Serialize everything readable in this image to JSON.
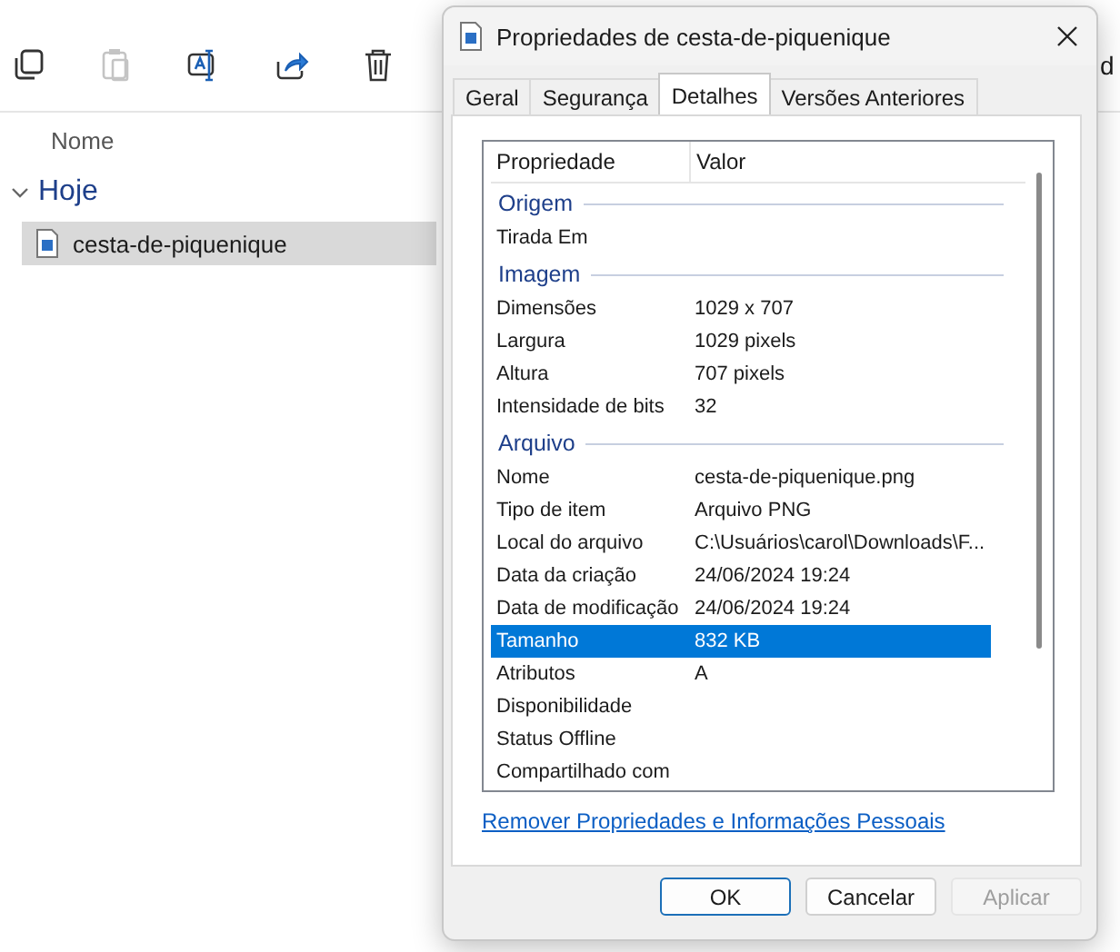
{
  "explorer": {
    "toolbar": [
      {
        "kind": "copy",
        "disabled": false
      },
      {
        "kind": "paste",
        "disabled": true
      },
      {
        "kind": "rename",
        "disabled": false
      },
      {
        "kind": "share",
        "disabled": false
      },
      {
        "kind": "delete",
        "disabled": false
      }
    ],
    "column_header": "Nome",
    "group": {
      "label": "Hoje",
      "expanded": true
    },
    "files": [
      {
        "name": "cesta-de-piquenique",
        "selected": true
      }
    ],
    "background_text": "d"
  },
  "dialog": {
    "title": "Propriedades de cesta-de-piquenique",
    "tabs": [
      {
        "label": "Geral",
        "selected": false
      },
      {
        "label": "Segurança",
        "selected": false
      },
      {
        "label": "Detalhes",
        "selected": true
      },
      {
        "label": "Versões Anteriores",
        "selected": false
      }
    ],
    "list": {
      "columns": [
        "Propriedade",
        "Valor"
      ],
      "sections": [
        {
          "heading": "Origem",
          "rows": [
            {
              "property": "Tirada Em",
              "selected": false
            }
          ]
        },
        {
          "heading": "Imagem",
          "rows": [
            {
              "property": "Dimensões",
              "value": "1029 x 707",
              "selected": false
            },
            {
              "property": "Largura",
              "value": "1029 pixels",
              "selected": false
            },
            {
              "property": "Altura",
              "value": "707 pixels",
              "selected": false
            },
            {
              "property": "Intensidade de bits",
              "value": "32",
              "selected": false
            }
          ]
        },
        {
          "heading": "Arquivo",
          "rows": [
            {
              "property": "Nome",
              "value": "cesta-de-piquenique.png",
              "selected": false
            },
            {
              "property": "Tipo de item",
              "value": "Arquivo PNG",
              "selected": false
            },
            {
              "property": "Local do arquivo",
              "value": "C:\\Usuários\\carol\\Downloads\\F...",
              "selected": false
            },
            {
              "property": "Data da criação",
              "value": "24/06/2024 19:24",
              "selected": false
            },
            {
              "property": "Data de modificação",
              "value": "24/06/2024 19:24",
              "selected": false
            },
            {
              "property": "Tamanho",
              "value": "832 KB",
              "selected": true
            },
            {
              "property": "Atributos",
              "value": "A",
              "selected": false
            },
            {
              "property": "Disponibilidade",
              "selected": false
            },
            {
              "property": "Status Offline",
              "selected": false
            },
            {
              "property": "Compartilhado com",
              "selected": false
            }
          ]
        }
      ]
    },
    "link": "Remover Propriedades e Informações Pessoais",
    "buttons": [
      {
        "label": "OK",
        "kind": "default",
        "disabled": false
      },
      {
        "label": "Cancelar",
        "kind": "normal",
        "disabled": false
      },
      {
        "label": "Aplicar",
        "kind": "normal",
        "disabled": true
      }
    ]
  }
}
